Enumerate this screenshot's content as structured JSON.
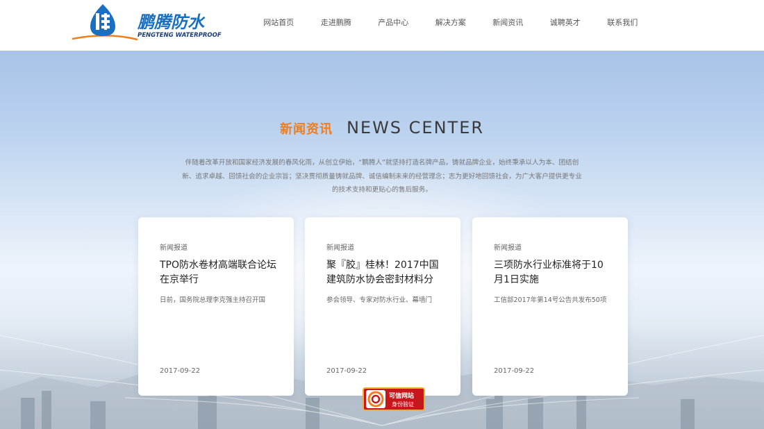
{
  "brand": {
    "name_cn": "鹏腾防水",
    "name_en": "PENGTENG WATERPROOF"
  },
  "nav": {
    "items": [
      {
        "label": "网站首页"
      },
      {
        "label": "走进鹏腾"
      },
      {
        "label": "产品中心"
      },
      {
        "label": "解决方案"
      },
      {
        "label": "新闻资讯"
      },
      {
        "label": "诚聘英才"
      },
      {
        "label": "联系我们"
      }
    ]
  },
  "section": {
    "title_cn": "新闻资讯",
    "title_en": "NEWS CENTER",
    "intro": "伴随着改革开放和国家经济发展的春风化雨，从创立伊始，“鹏腾人”就坚持打造名牌产品，铸就品牌企业，始终秉承以人为本、团结创新、追求卓越、回馈社会的企业宗旨；坚决贯彻质量铸就品牌、诚信编制未来的经营理念；志为更好地回馈社会，为广大客户提供更专业的技术支持和更贴心的售后服务。"
  },
  "news": [
    {
      "category": "新闻报道",
      "title": "TPO防水卷材高端联合论坛在京举行",
      "summary": "日前，国务院总理李克强主持召开国",
      "date": "2017-09-22"
    },
    {
      "category": "新闻报道",
      "title": "聚『胶』桂林！2017中国建筑防水协会密封材料分",
      "summary": "参会领导、专家对防水行业、幕墙门",
      "date": "2017-09-22"
    },
    {
      "category": "新闻报道",
      "title": "三项防水行业标准将于10月1日实施",
      "summary": "工信部2017年第14号公告共发布50项",
      "date": "2017-09-22"
    }
  ],
  "badge": {
    "line1": "可信网站",
    "line2": "身份验证"
  },
  "colors": {
    "accent_orange": "#f07d1e",
    "brand_blue": "#1a6fc0",
    "badge_red": "#c8161d"
  }
}
